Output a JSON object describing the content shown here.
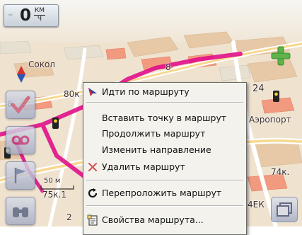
{
  "speed": {
    "value": "0",
    "unit_top": "КМ",
    "unit_bottom": "Ч"
  },
  "map_labels": {
    "sokol": "Сокол",
    "road_80": "80к",
    "num_8": "8",
    "num_24": "24",
    "num_75": "75к.1",
    "num_74": "74к.",
    "airport": "Аэропорт",
    "num_4eck": "4ЕК",
    "scale": "50 м",
    "num_8b": "8",
    "num_2b": "2"
  },
  "menu": {
    "items": [
      {
        "label": "Идти по маршруту",
        "icon": "navigate-arrow-icon"
      },
      {
        "label": "Вставить точку в маршрут",
        "icon": ""
      },
      {
        "label": "Продолжить маршрут",
        "icon": ""
      },
      {
        "label": "Изменить направление",
        "icon": ""
      },
      {
        "label": "Удалить маршрут",
        "icon": "delete-x-icon"
      },
      {
        "label": "Перепроложить маршрут",
        "icon": "refresh-icon"
      },
      {
        "label": "Свойства маршрута...",
        "icon": "properties-icon"
      }
    ]
  },
  "colors": {
    "route": "#e0108a",
    "menu_bg": "#f3f2ec",
    "map_base": "#efe3cf"
  }
}
